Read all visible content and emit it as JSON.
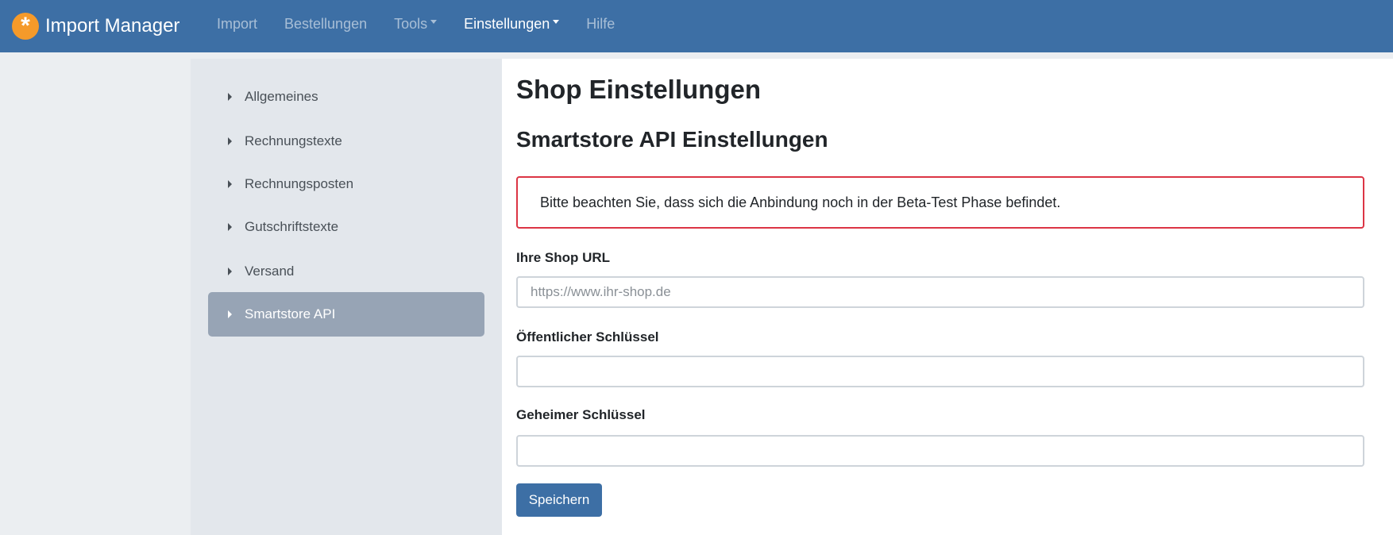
{
  "navbar": {
    "brand": "Import Manager",
    "brand_icon": "asterisk-logo-icon",
    "links": [
      {
        "label": "Import",
        "active": false,
        "dropdown": false
      },
      {
        "label": "Bestellungen",
        "active": false,
        "dropdown": false
      },
      {
        "label": "Tools",
        "active": false,
        "dropdown": true
      },
      {
        "label": "Einstellungen",
        "active": true,
        "dropdown": true
      },
      {
        "label": "Hilfe",
        "active": false,
        "dropdown": false
      }
    ]
  },
  "sidebar": {
    "items": [
      {
        "label": "Allgemeines",
        "active": false
      },
      {
        "label": "Rechnungstexte",
        "active": false
      },
      {
        "label": "Rechnungsposten",
        "active": false
      },
      {
        "label": "Gutschriftstexte",
        "active": false
      },
      {
        "label": "Versand",
        "active": false
      },
      {
        "label": "Smartstore API",
        "active": true
      }
    ]
  },
  "main": {
    "title": "Shop Einstellungen",
    "subtitle": "Smartstore API Einstellungen",
    "alert": "Bitte beachten Sie, dass sich die Anbindung noch in der Beta-Test Phase befindet.",
    "fields": {
      "shop_url": {
        "label": "Ihre Shop URL",
        "value": "",
        "placeholder": "https://www.ihr-shop.de"
      },
      "public_key": {
        "label": "Öffentlicher Schlüssel",
        "value": "",
        "placeholder": ""
      },
      "secret_key": {
        "label": "Geheimer Schlüssel",
        "value": "",
        "placeholder": ""
      }
    },
    "save_label": "Speichern"
  },
  "colors": {
    "navbar": "#3d6fa5",
    "logo": "#f59a2a",
    "alert_border": "#dc3545",
    "sidebar_active": "#97a4b5",
    "button": "#3d6fa5"
  }
}
